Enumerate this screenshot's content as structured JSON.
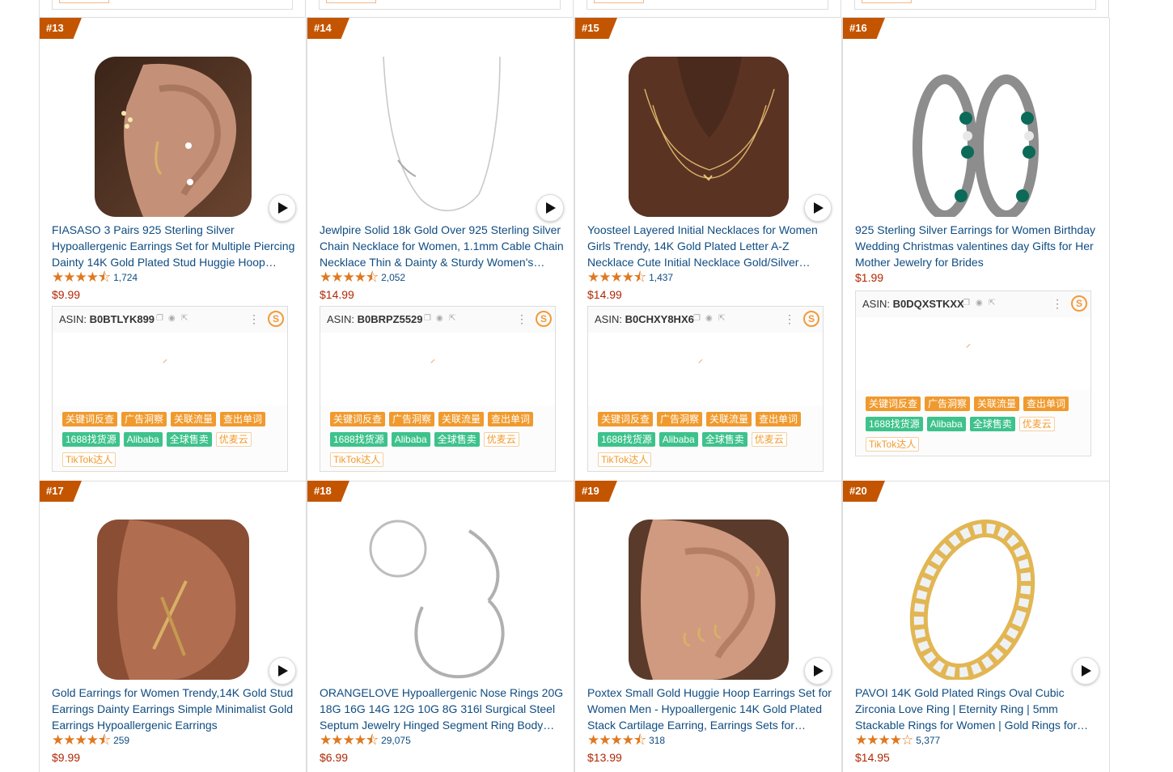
{
  "asin_label": "ASIN:",
  "tag_labels": {
    "keyword_reverse": "关键词反查",
    "ad_insight": "广告洞察",
    "related_traffic": "关联流量",
    "sold_words": "查出单词",
    "source_1688": "1688找货源",
    "alibaba": "Alibaba",
    "global_sales": "全球售卖",
    "youmaiyun": "优麦云",
    "tiktok": "TikTok达人"
  },
  "products": [
    {
      "rank": "#13",
      "title": "FIASASO 3 Pairs 925 Sterling Silver Hypoallergenic Earrings Set for Multiple Piercing Dainty 14K Gold Plated Stud Huggie Hoop Earrings",
      "stars": "★★★★⯪",
      "rating_value": 4.5,
      "reviews": "1,724",
      "price": "$9.99",
      "asin": "B0BTLYK899",
      "image": "earring-ear-photo"
    },
    {
      "rank": "#14",
      "title": "Jewlpire Solid 18k Gold Over 925 Sterling Silver Chain Necklace for Women, 1.1mm Cable Chain Necklace Thin & Dainty & Sturdy Women's Chain",
      "stars": "★★★★⯪",
      "rating_value": 4.5,
      "reviews": "2,052",
      "price": "$14.99",
      "asin": "B0BRPZ5529",
      "image": "silver-chain-photo"
    },
    {
      "rank": "#15",
      "title": "Yoosteel Layered Initial Necklaces for Women Girls Trendy, 14K Gold Plated Letter A-Z Necklace Cute Initial Necklace Gold/Silver Layering",
      "stars": "★★★★⯪",
      "rating_value": 4.5,
      "reviews": "1,437",
      "price": "$14.99",
      "asin": "B0CHXY8HX6",
      "image": "necklace-neck-photo"
    },
    {
      "rank": "#16",
      "title": "925 Sterling Silver Earrings for Women Birthday Wedding Christmas valentines day Gifts for Her Mother Jewelry for Brides",
      "stars": "",
      "rating_value": null,
      "reviews": "",
      "price": "$1.99",
      "asin": "B0DQXSTKXX",
      "image": "hoop-earrings-emerald-photo"
    },
    {
      "rank": "#17",
      "title": "Gold Earrings for Women Trendy,14K Gold Stud Earrings Dainty Earrings Simple Minimalist Gold Earrings Hypoallergenic Earrings",
      "stars": "★★★★⯪",
      "rating_value": 4.5,
      "reviews": "259",
      "price": "$9.99",
      "asin": "",
      "image": "criss-cross-earring-photo"
    },
    {
      "rank": "#18",
      "title": "ORANGELOVE Hypoallergenic Nose Rings 20G 18G 16G 14G 12G 10G 8G 316l Surgical Steel Septum Jewelry Hinged Segment Ring Body Piercing",
      "stars": "★★★★⯪",
      "rating_value": 4.5,
      "reviews": "29,075",
      "price": "$6.99",
      "asin": "",
      "image": "steel-hoop-rings-photo"
    },
    {
      "rank": "#19",
      "title": "Poxtex Small Gold Huggie Hoop Earrings Set for Women Men - Hypoallergenic 14K Gold Plated Stack Cartilage Earring, Earrings Sets for Multiple Piercing",
      "stars": "★★★★⯪",
      "rating_value": 4.5,
      "reviews": "318",
      "price": "$13.99",
      "asin": "",
      "image": "huggie-ear-photo"
    },
    {
      "rank": "#20",
      "title": "PAVOI 14K Gold Plated Rings Oval Cubic Zirconia Love Ring | Eternity Ring | 5mm Stackable Rings for Women | Gold Rings for Women",
      "stars": "★★★★☆",
      "rating_value": 4.0,
      "reviews": "5,377",
      "price": "$14.95",
      "asin": "",
      "image": "eternity-ring-photo"
    }
  ],
  "colors": {
    "rank_badge": "#c45500",
    "link": "#0F4C81",
    "price": "#B12704",
    "star": "#de7921",
    "tag_orange": "#f09a2e",
    "tag_green": "#3ec28c"
  }
}
